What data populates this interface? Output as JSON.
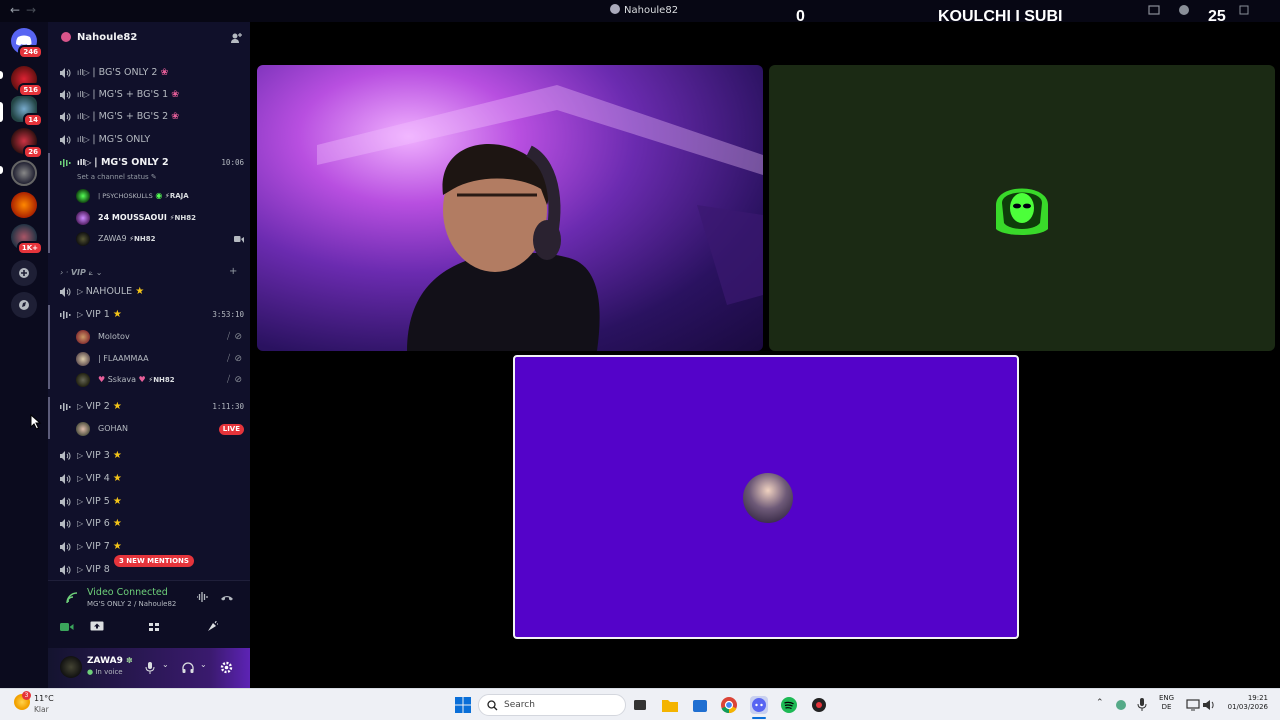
{
  "window": {
    "title": "Nahoule82",
    "scoreboard": {
      "left_score": "0",
      "title": "KOULCHI I SUBI",
      "right_score": "25"
    }
  },
  "rail": {
    "servers": [
      {
        "name": "home",
        "badge": "246"
      },
      {
        "name": "server-1",
        "badge": "516"
      },
      {
        "name": "server-2",
        "badge": "14"
      },
      {
        "name": "server-3",
        "badge": "26"
      },
      {
        "name": "server-4",
        "badge": ""
      },
      {
        "name": "server-5",
        "badge": ""
      },
      {
        "name": "server-6",
        "badge": "1K+"
      }
    ]
  },
  "sidebar": {
    "server_name": "Nahoule82",
    "channels": [
      {
        "label": "| BG'S ONLY 2"
      },
      {
        "label": "| MG'S + BG'S 1"
      },
      {
        "label": "| MG'S + BG'S 2"
      },
      {
        "label": "| MG'S ONLY"
      },
      {
        "label": "| MG'S ONLY 2",
        "time": "10:06",
        "status": "Set a channel status"
      }
    ],
    "mgs2_users": [
      {
        "name": "| PSYCHOSKULLS",
        "tag": "RAJA"
      },
      {
        "name": "24 MOUSSAOUI",
        "tag": "NH82"
      },
      {
        "name": "ZAWA9",
        "tag": "NH82"
      }
    ],
    "vip_category": "VIP",
    "vip_channels": [
      {
        "label": "NAHOULE"
      },
      {
        "label": "VIP 1",
        "time": "3:53:10"
      },
      {
        "label": "VIP 2",
        "time": "1:11:30"
      },
      {
        "label": "VIP 3"
      },
      {
        "label": "VIP 4"
      },
      {
        "label": "VIP 5"
      },
      {
        "label": "VIP 6"
      },
      {
        "label": "VIP 7"
      },
      {
        "label": "VIP 8"
      }
    ],
    "vip1_users": [
      {
        "name": "Molotov",
        "tag": ""
      },
      {
        "name": "| FLAAMMAA",
        "tag": ""
      },
      {
        "name": "Sskava",
        "tag": "NH82"
      }
    ],
    "vip2_users": [
      {
        "name": "GOHAN",
        "live": "LIVE"
      }
    ],
    "mentions": "3 NEW MENTIONS"
  },
  "voice": {
    "title": "Video Connected",
    "subtitle": "MG'S ONLY 2 / Nahoule82"
  },
  "user_panel": {
    "name": "ZAWA9",
    "status": "In voice"
  },
  "taskbar": {
    "weather_temp": "11°C",
    "weather_text": "Klar",
    "search_placeholder": "Search",
    "lang_1": "ENG",
    "lang_2": "DE",
    "time": "19:21",
    "date": "01/03/2026",
    "notification_count": "3"
  },
  "colors": {
    "accent": "#5403c9",
    "connected_green": "#6ed07a",
    "live_red": "#e5343b",
    "alien_bg": "#1b2a14"
  }
}
